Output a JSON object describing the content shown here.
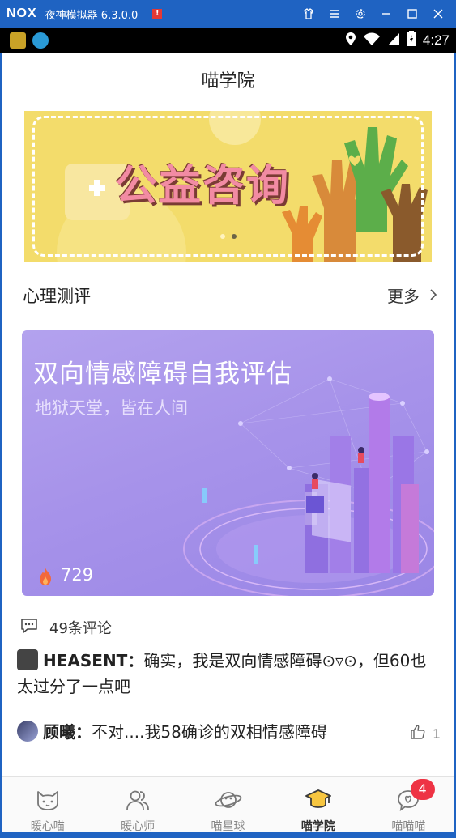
{
  "emulator": {
    "logo": "NOX",
    "title": "夜神模拟器 6.3.0.0",
    "warn_label": "!"
  },
  "status_bar": {
    "time": "4:27",
    "icons": [
      "location-icon",
      "wifi-icon",
      "signal-icon",
      "battery-icon"
    ]
  },
  "page": {
    "title": "喵学院"
  },
  "banner": {
    "text": "公益咨询",
    "colors": {
      "bg": "#f3dc6b",
      "text": "#f28ba3"
    },
    "slide_count": 2,
    "active_slide": 2
  },
  "section": {
    "title": "心理测评",
    "more_label": "更多"
  },
  "test_card": {
    "title": "双向情感障碍自我评估",
    "subtitle": "地狱天堂，皆在人间",
    "count": "729"
  },
  "comments": {
    "count_label": "49条评论",
    "items": [
      {
        "name": "HEASENT",
        "sep": "：",
        "text": "确实，我是双向情感障碍⊙▿⊙，但60也太过分了一点吧"
      },
      {
        "name": "顾曦",
        "sep": "：",
        "text": "不对....我58确诊的双相情感障碍",
        "likes": "1"
      }
    ]
  },
  "bottom_nav": {
    "items": [
      {
        "label": "暖心喵",
        "icon": "cat-icon"
      },
      {
        "label": "暖心师",
        "icon": "users-icon"
      },
      {
        "label": "喵星球",
        "icon": "planet-icon"
      },
      {
        "label": "喵学院",
        "icon": "graduation-cap-icon",
        "active": true
      },
      {
        "label": "喵喵喵",
        "icon": "heart-chat-icon",
        "badge": "4"
      }
    ]
  }
}
